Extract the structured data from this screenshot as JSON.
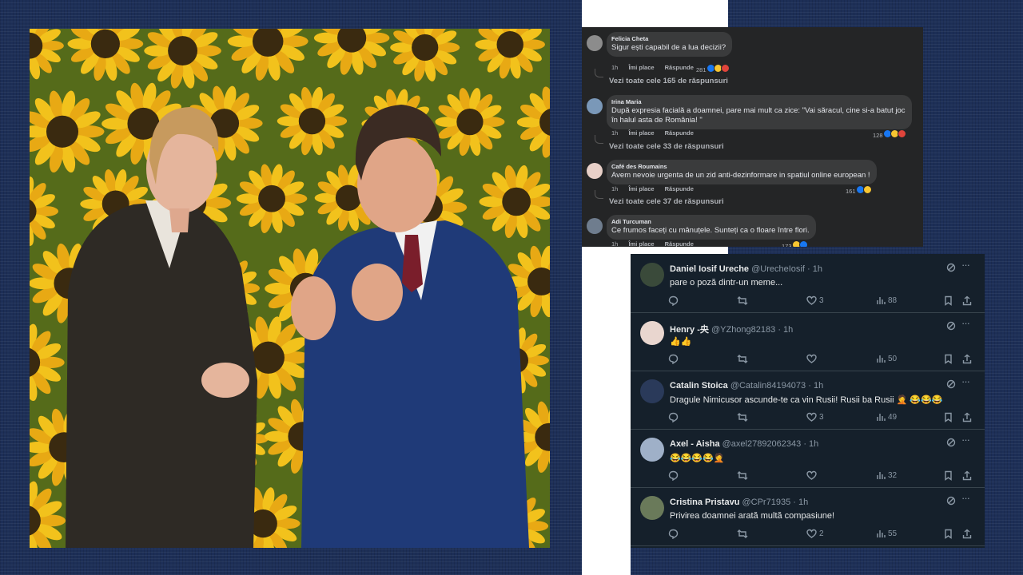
{
  "facebook": {
    "action_like": "Îmi place",
    "action_reply": "Răspunde",
    "comments": [
      {
        "name": "Felicia Cheta",
        "text_lines": [
          "Sigur ești capabil de a lua decizii?"
        ],
        "time": "1h",
        "reactions": "281",
        "more": "Vezi toate cele 165 de răspunsuri"
      },
      {
        "name": "Irina Maria",
        "text_lines": [
          "După expresia facială a doamnei, pare mai mult ca zice: \"Vai săracul, cine si-a batut joc",
          "în halul asta de România! \""
        ],
        "time": "1h",
        "reactions": "128",
        "more": "Vezi toate cele 33 de răspunsuri"
      },
      {
        "name": "Café des Roumains",
        "text_lines": [
          "Avem nevoie urgenta de un zid anti-dezinformare in spatiul online european !"
        ],
        "time": "1h",
        "reactions": "161",
        "more": "Vezi toate cele 37 de răspunsuri"
      },
      {
        "name": "Adi Turcuman",
        "text_lines": [
          "Ce frumos faceți cu mânuțele. Sunteți ca o floare între flori."
        ],
        "time": "1h",
        "reactions": "173",
        "more": ""
      }
    ]
  },
  "twitter": {
    "posts": [
      {
        "name": "Daniel Iosif Ureche",
        "handle": "@UrecheIosif",
        "time": "· 1h",
        "text": "pare o poză dintr-un meme...",
        "likes": "3",
        "views": "88",
        "emoji_count": 0
      },
      {
        "name": "Henry -央",
        "handle": "@YZhong82183",
        "time": "· 1h",
        "text": "👍👍",
        "likes": "",
        "views": "50",
        "emoji_count": 0
      },
      {
        "name": "Catalin Stoica",
        "handle": "@Catalin84194073",
        "time": "· 1h",
        "text": "Dragule Nimicusor ascunde-te ca vin Rusii! Rusii ba Rusii 🤦 😂😂😂",
        "likes": "3",
        "views": "49",
        "emoji_count": 0
      },
      {
        "name": "Axel - Aisha",
        "handle": "@axel27892062343",
        "time": "· 1h",
        "text": "😂😂😂😂🤦",
        "likes": "",
        "views": "32",
        "emoji_count": 0
      },
      {
        "name": "Cristina Pristavu",
        "handle": "@CPr71935",
        "time": "· 1h",
        "text": "Privirea doamnei arată multă compasiune!",
        "likes": "2",
        "views": "55",
        "emoji_count": 0
      }
    ]
  },
  "icons": {
    "reply": "reply-icon",
    "retweet": "retweet-icon",
    "like": "heart-icon",
    "views": "views-icon",
    "bookmark": "bookmark-icon",
    "share": "share-icon",
    "grok": "grok-icon",
    "more": "more-icon"
  },
  "colors": {
    "background": "#1d2f57",
    "fb_panel": "#242526",
    "fb_bubble": "#3a3b3c",
    "tw_panel": "#15202b",
    "like_blue": "#1877f2",
    "haha_yellow": "#f7c531",
    "angry_red": "#e0443b"
  }
}
